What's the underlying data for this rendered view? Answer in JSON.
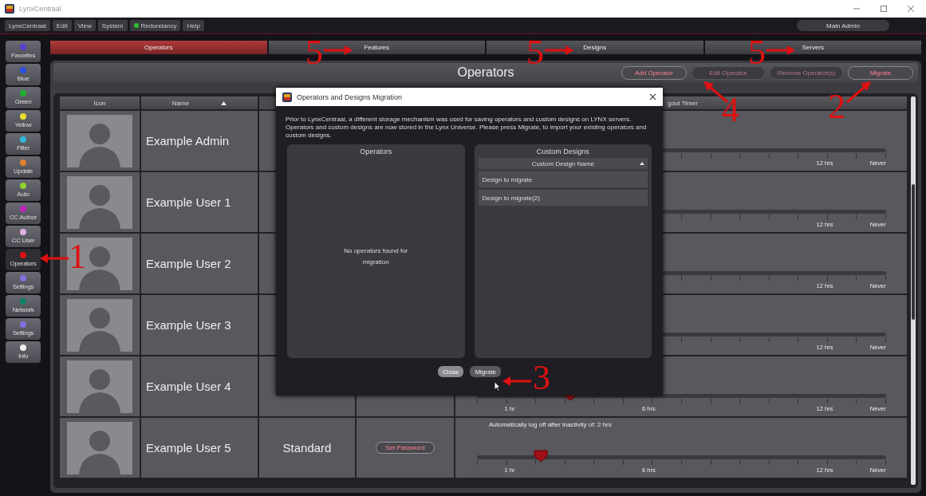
{
  "window": {
    "title": "LynxCentraal"
  },
  "menu": [
    {
      "label": "LynxCentraal",
      "kind": "plain"
    },
    {
      "label": "Edit",
      "kind": "plain"
    },
    {
      "label": "View",
      "kind": "plain"
    },
    {
      "label": "System",
      "kind": "plain"
    },
    {
      "label": "Redundancy",
      "kind": "status"
    },
    {
      "label": "Help",
      "kind": "plain"
    }
  ],
  "user_button": "Main Admin",
  "sidebar": {
    "items": [
      {
        "label": "Favorites",
        "color": "#5b3fd0",
        "selected": false
      },
      {
        "label": "Blue",
        "color": "#2a50e0",
        "selected": false
      },
      {
        "label": "Green",
        "color": "#22b030",
        "selected": false
      },
      {
        "label": "Yellow",
        "color": "#e8e030",
        "selected": false
      },
      {
        "label": "Filter",
        "color": "#30b8d8",
        "selected": false
      },
      {
        "label": "Update",
        "color": "#e08030",
        "selected": false
      },
      {
        "label": "Auto",
        "color": "#90d030",
        "selected": false
      },
      {
        "label": "CC Author",
        "color": "#c020c0",
        "selected": false
      },
      {
        "label": "CC User",
        "color": "#e0b0e0",
        "selected": false
      },
      {
        "label": "Operators",
        "color": "#e01010",
        "selected": true
      },
      {
        "label": "Settings",
        "color": "#8070e0",
        "selected": false
      },
      {
        "label": "Network",
        "color": "#108060",
        "selected": false
      },
      {
        "label": "Settings",
        "color": "#8070e0",
        "selected": false
      },
      {
        "label": "Info",
        "color": "#f0f0f0",
        "selected": false
      }
    ]
  },
  "tabs": [
    {
      "label": "Operators",
      "selected": true
    },
    {
      "label": "Features",
      "selected": false
    },
    {
      "label": "Designs",
      "selected": false
    },
    {
      "label": "Servers",
      "selected": false
    }
  ],
  "panel": {
    "title": "Operators",
    "buttons": [
      {
        "label": "Add Operator",
        "disabled": false
      },
      {
        "label": "Edit Operator",
        "disabled": true
      },
      {
        "label": "Remove Operator(s)",
        "disabled": true
      },
      {
        "label": "Migrate",
        "disabled": false
      }
    ]
  },
  "table": {
    "columns": [
      {
        "label": "Icon",
        "sorted": false
      },
      {
        "label": "Name",
        "sorted": true
      },
      {
        "label": "gout Timer",
        "sorted": false
      }
    ],
    "rows": [
      {
        "name": "Example Admin",
        "timer": {
          "labels": [
            {
              "kind": "twelve",
              "text": "12 hrs"
            },
            {
              "kind": "never",
              "text": "Never"
            }
          ]
        }
      },
      {
        "name": "Example User 1",
        "timer": {
          "labels": [
            {
              "kind": "twelve",
              "text": "12 hrs"
            },
            {
              "kind": "never",
              "text": "Never"
            }
          ]
        }
      },
      {
        "name": "Example User 2",
        "timer": {
          "labels": [
            {
              "kind": "twelve",
              "text": "12 hrs"
            },
            {
              "kind": "never",
              "text": "Never"
            }
          ]
        }
      },
      {
        "name": "Example User 3",
        "timer": {
          "labels": [
            {
              "kind": "twelve",
              "text": "12 hrs"
            },
            {
              "kind": "never",
              "text": "Never"
            }
          ]
        }
      },
      {
        "name": "Example User 4",
        "timer": {
          "level": 0.22,
          "labels": [
            {
              "kind": "one",
              "text": "1 hr"
            },
            {
              "kind": "six",
              "text": "6 hrs"
            },
            {
              "kind": "twelve",
              "text": "12 hrs"
            },
            {
              "kind": "never",
              "text": "Never"
            }
          ]
        }
      },
      {
        "name": "Example User 5",
        "role": "Standard",
        "password_button": "Set Password",
        "timer": {
          "caption": "Automatically log off after inactivity of: 2 hrs",
          "level": 0.15,
          "labels": [
            {
              "kind": "one",
              "text": "1 hr"
            },
            {
              "kind": "six",
              "text": "6 hrs"
            },
            {
              "kind": "twelve",
              "text": "12 hrs"
            },
            {
              "kind": "never",
              "text": "Never"
            }
          ]
        }
      }
    ]
  },
  "dialog": {
    "title": "Operators and Designs Migration",
    "message": "Prior to LynxCentraal, a different storage mechanism was used for saving operators and custom designs on LYNX servers. Operators and custom designs are now stored in the Lynx Universe. Please press Migrate, to import your existing operators and custom designs.",
    "operators_panel": {
      "title": "Operators",
      "empty_text": "No operators found for migration"
    },
    "designs_panel": {
      "title": "Custom Designs",
      "column": "Custom Design Name",
      "rows": [
        "Design to migrate",
        "Design to migrate(2)"
      ]
    },
    "buttons": [
      "Close",
      "Migrate"
    ]
  },
  "annotations": [
    {
      "text": "1",
      "kind": "left"
    },
    {
      "text": "2",
      "kind": "up-right"
    },
    {
      "text": "3",
      "kind": "left"
    },
    {
      "text": "4",
      "kind": "up-left"
    },
    {
      "text": "5",
      "kind": "right"
    },
    {
      "text": "5",
      "kind": "right"
    },
    {
      "text": "5",
      "kind": "right"
    }
  ]
}
